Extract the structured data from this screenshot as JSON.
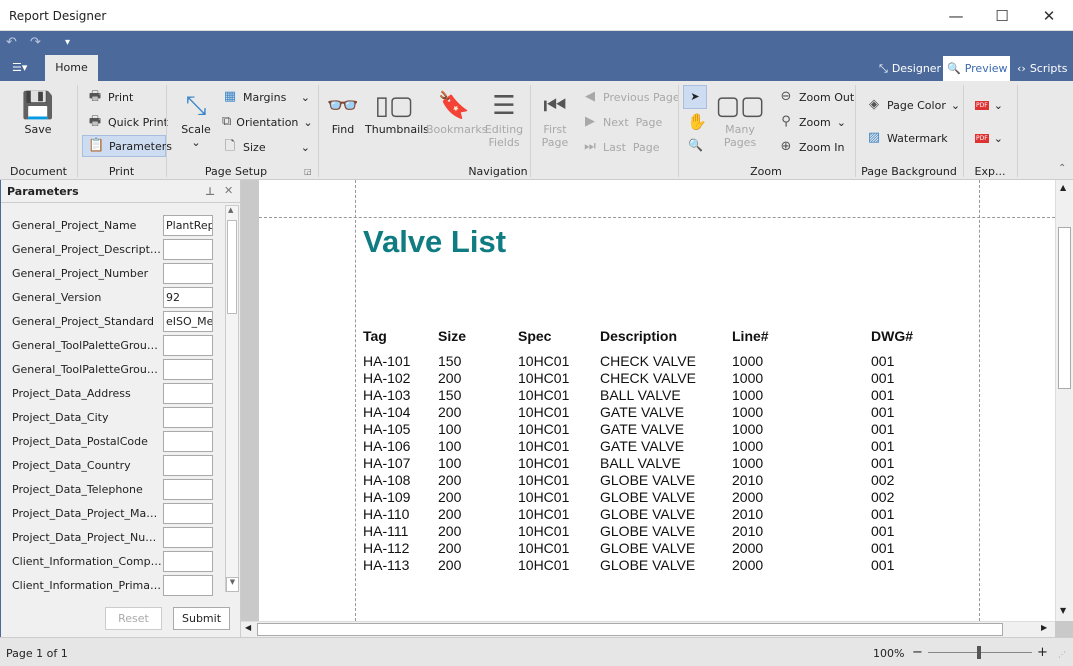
{
  "window": {
    "title": "Report Designer",
    "minimize": "—",
    "maximize": "☐",
    "close": "✕"
  },
  "qat": {
    "undo": "↶",
    "redo": "↷",
    "customize": "▾"
  },
  "tabs": {
    "file_menu": "☰▾",
    "home": "Home"
  },
  "views": [
    {
      "label": "Designer",
      "icon": "designer-icon",
      "glyph": "⤡",
      "active": false
    },
    {
      "label": "Preview",
      "icon": "preview-icon",
      "glyph": "🔍",
      "active": true
    },
    {
      "label": "Scripts",
      "icon": "scripts-icon",
      "glyph": "‹›",
      "active": false
    }
  ],
  "ribbon": {
    "groups": {
      "document": "Document",
      "print": "Print",
      "page_setup": "Page Setup",
      "navigation": "Navigation",
      "zoom": "Zoom",
      "page_background": "Page Background",
      "export": "Exp..."
    },
    "save": "Save",
    "print": "Print",
    "quick_print": "Quick Print",
    "parameters": "Parameters",
    "scale": "Scale",
    "margins": "Margins",
    "orientation": "Orientation",
    "size": "Size",
    "find": "Find",
    "thumbnails": "Thumbnails",
    "bookmarks": "Bookmarks",
    "editing_fields_1": "Editing",
    "editing_fields_2": "Fields",
    "first_page_1": "First",
    "first_page_2": "Page",
    "previous_page": "Previous Page",
    "next_page": "Next  Page",
    "last_page": "Last  Page",
    "many_pages": "Many Pages",
    "zoom_out": "Zoom Out",
    "zoom": "Zoom",
    "zoom_in": "Zoom In",
    "page_color": "Page Color",
    "watermark": "Watermark",
    "export_pdf": "PDF",
    "email_pdf": "PDF"
  },
  "parameters_panel": {
    "title": "Parameters",
    "items": [
      {
        "label": "General_Project_Name",
        "value": "PlantRep"
      },
      {
        "label": "General_Project_Description",
        "value": ""
      },
      {
        "label": "General_Project_Number",
        "value": ""
      },
      {
        "label": "General_Version",
        "value": "92"
      },
      {
        "label": "General_Project_Standard",
        "value": "eISO_Me"
      },
      {
        "label": "General_ToolPaletteGroup...",
        "value": ""
      },
      {
        "label": "General_ToolPaletteGroup...",
        "value": ""
      },
      {
        "label": "Project_Data_Address",
        "value": ""
      },
      {
        "label": "Project_Data_City",
        "value": ""
      },
      {
        "label": "Project_Data_PostalCode",
        "value": ""
      },
      {
        "label": "Project_Data_Country",
        "value": ""
      },
      {
        "label": "Project_Data_Telephone",
        "value": ""
      },
      {
        "label": "Project_Data_Project_Man...",
        "value": ""
      },
      {
        "label": "Project_Data_Project_Number",
        "value": ""
      },
      {
        "label": "Client_Information_Compa...",
        "value": ""
      },
      {
        "label": "Client_Information_Primar...",
        "value": ""
      }
    ],
    "reset": "Reset",
    "submit": "Submit"
  },
  "report": {
    "title": "Valve List",
    "title_color": "#0e7c80",
    "columns": [
      "Tag",
      "Size",
      "Spec",
      "Description",
      "Line#",
      "DWG#"
    ],
    "rows": [
      [
        "HA-101",
        "150",
        "10HC01",
        "CHECK VALVE",
        "1000",
        "001"
      ],
      [
        "HA-102",
        "200",
        "10HC01",
        "CHECK VALVE",
        "1000",
        "001"
      ],
      [
        "HA-103",
        "150",
        "10HC01",
        "BALL VALVE",
        "1000",
        "001"
      ],
      [
        "HA-104",
        "200",
        "10HC01",
        "GATE VALVE",
        "1000",
        "001"
      ],
      [
        "HA-105",
        "100",
        "10HC01",
        "GATE VALVE",
        "1000",
        "001"
      ],
      [
        "HA-106",
        "100",
        "10HC01",
        "GATE VALVE",
        "1000",
        "001"
      ],
      [
        "HA-107",
        "100",
        "10HC01",
        "BALL VALVE",
        "1000",
        "001"
      ],
      [
        "HA-108",
        "200",
        "10HC01",
        "GLOBE VALVE",
        "2010",
        "002"
      ],
      [
        "HA-109",
        "200",
        "10HC01",
        "GLOBE VALVE",
        "2000",
        "002"
      ],
      [
        "HA-110",
        "200",
        "10HC01",
        "GLOBE VALVE",
        "2010",
        "001"
      ],
      [
        "HA-111",
        "200",
        "10HC01",
        "GLOBE VALVE",
        "2010",
        "001"
      ],
      [
        "HA-112",
        "200",
        "10HC01",
        "GLOBE VALVE",
        "2000",
        "001"
      ],
      [
        "HA-113",
        "200",
        "10HC01",
        "GLOBE VALVE",
        "2000",
        "001"
      ]
    ]
  },
  "status": {
    "page": "Page 1 of 1",
    "zoom": "100%",
    "zoom_minus": "−",
    "zoom_plus": "+"
  },
  "colors": {
    "accent": "#4b6a9b",
    "ribbon": "#e9e9e9"
  }
}
